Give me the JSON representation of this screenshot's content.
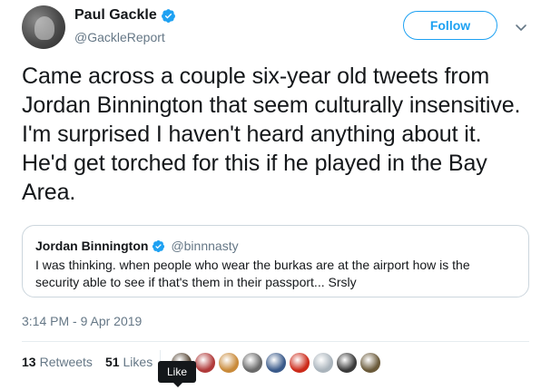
{
  "author": {
    "display_name": "Paul Gackle",
    "handle": "@GackleReport"
  },
  "follow_label": "Follow",
  "tweet_text": "Came across a couple six-year old tweets from Jordan Binnington that seem culturally insensitive. I'm surprised I haven't heard anything about it. He'd get torched for this if he played in the Bay Area.",
  "quoted": {
    "display_name": "Jordan Binnington",
    "handle": "@binnnasty",
    "text": "I was thinking. when people who wear the burkas are at the airport how is the security able to see if that's them in their passport... Srsly"
  },
  "timestamp": "3:14 PM - 9 Apr 2019",
  "stats": {
    "retweets_count": "13",
    "retweets_label": "Retweets",
    "likes_count": "51",
    "likes_label": "Likes"
  },
  "likers": [
    {
      "icon": "liker-avatar",
      "color": "#5a4a3a"
    },
    {
      "icon": "liker-avatar",
      "color": "#b03a3a"
    },
    {
      "icon": "liker-avatar",
      "color": "#c98a3a"
    },
    {
      "icon": "liker-avatar",
      "color": "#6a6a6a"
    },
    {
      "icon": "liker-avatar",
      "color": "#3a5a8a"
    },
    {
      "icon": "liker-avatar",
      "color": "#cc2a1a"
    },
    {
      "icon": "liker-avatar",
      "color": "#aab4bc"
    },
    {
      "icon": "liker-avatar",
      "color": "#3a3a3a"
    },
    {
      "icon": "liker-avatar",
      "color": "#6a5a3a"
    }
  ],
  "tooltip_label": "Like",
  "colors": {
    "accent": "#1da1f2",
    "text": "#14171a",
    "secondary": "#657786",
    "border": "#ccd6dd"
  }
}
